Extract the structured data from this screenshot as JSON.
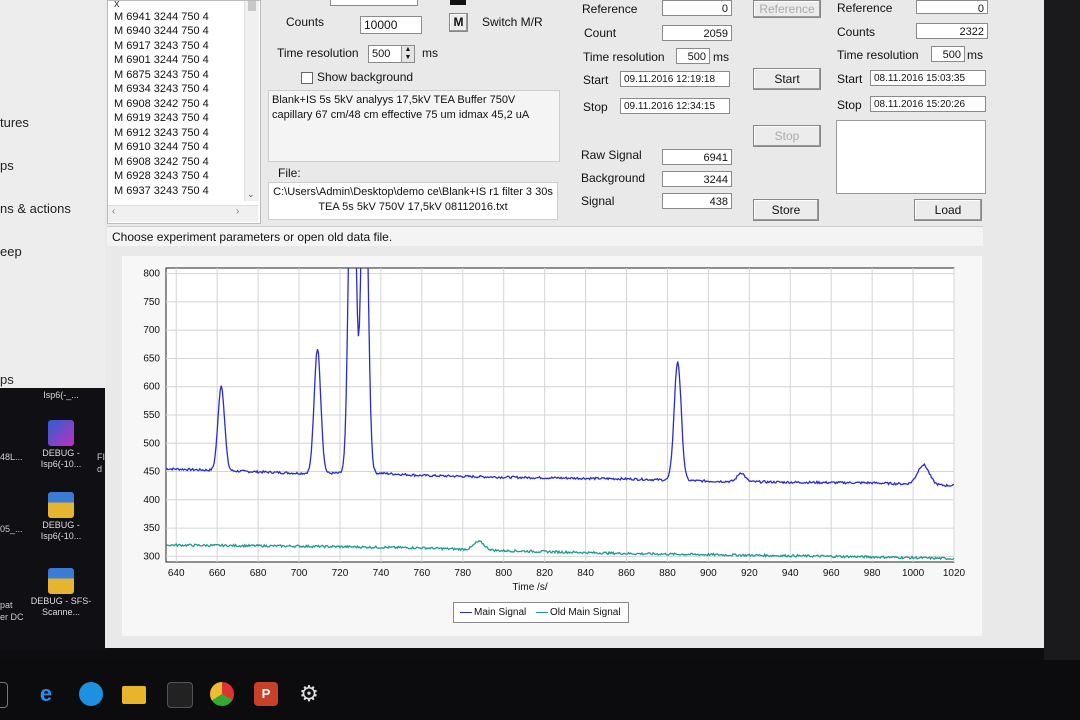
{
  "background_window": {
    "items": [
      "tures",
      "ps",
      "ns & actions",
      "eep",
      "ps"
    ]
  },
  "desktop": {
    "icons": [
      {
        "label": "Isp6(-_...",
        "color": "#1a1a1a"
      },
      {
        "label": "DEBUG - Isp6(-10...",
        "color": "#2a5fd0"
      },
      {
        "label": "DEBUG - Isp6(-10...",
        "color": "#3a7bd5"
      },
      {
        "label": "DEBUG - SFS-Scanne...",
        "color": "#3a7bd5"
      }
    ],
    "partial_labels": [
      "48L...",
      "05_...",
      "pat",
      "er DC",
      "FI",
      "d"
    ]
  },
  "taskbar": {
    "icons": [
      "windows-icon",
      "edge-icon",
      "skype-icon",
      "file-explorer-icon",
      "app-icon",
      "chrome-icon",
      "powerpoint-icon",
      "settings-icon"
    ]
  },
  "list": {
    "close": "x",
    "rows": [
      "M 6941 3244 750 4",
      "M 6940 3244 750 4",
      "M 6917 3243 750 4",
      "M 6901 3244 750 4",
      "M 6875 3243 750 4",
      "M 6934 3243 750 4",
      "M 6908 3242 750 4",
      "M 6919 3243 750 4",
      "M 6912 3243 750 4",
      "M 6910 3244 750 4",
      "M 6908 3242 750 4",
      "M 6928 3243 750 4",
      "M 6937 3243 750 4"
    ]
  },
  "params": {
    "counts_label": "Counts",
    "counts_value": "10000",
    "m_button": "M",
    "switch_label": "Switch M/R",
    "time_res_label": "Time resolution",
    "time_res_value": "500",
    "time_res_unit": "ms",
    "show_background_label": "Show background",
    "description": "Blank+IS 5s 5kV analyys 17,5kV TEA Buffer 750V capillary 67 cm/48 cm effective 75 um idmax 45,2 uA",
    "file_label": "File:",
    "file_path": "C:\\Users\\Admin\\Desktop\\demo ce\\Blank+IS r1 filter 3 30s TEA 5s 5kV 750V 17,5kV 08112016.txt"
  },
  "current": {
    "reference_label": "Reference",
    "reference_value": "0",
    "count_label": "Count",
    "count_value": "2059",
    "time_res_label": "Time resolution",
    "time_res_value": "500",
    "time_res_unit": "ms",
    "start_label": "Start",
    "start_value": "09.11.2016 12:19:18",
    "stop_label": "Stop",
    "stop_value": "09.11.2016 12:34:15",
    "raw_signal_label": "Raw Signal",
    "raw_signal_value": "6941",
    "background_label": "Background",
    "background_value": "3244",
    "signal_label": "Signal",
    "signal_value": "438"
  },
  "buttons": {
    "reference": "Reference",
    "start": "Start",
    "stop": "Stop",
    "store": "Store",
    "load": "Load"
  },
  "old": {
    "reference_label": "Reference",
    "reference_value": "0",
    "counts_label": "Counts",
    "counts_value": "2322",
    "time_res_label": "Time resolution",
    "time_res_value": "500",
    "time_res_unit": "ms",
    "start_label": "Start",
    "start_value": "08.11.2016 15:03:35",
    "stop_label": "Stop",
    "stop_value": "08.11.2016 15:20:26"
  },
  "status_text": "Choose experiment parameters or open old data file.",
  "colors": {
    "main_signal": "#2b2bd0",
    "old_main_signal": "#1e9a8e"
  },
  "chart_data": {
    "type": "line",
    "title": "",
    "xlabel": "Time /s/",
    "ylabel": "",
    "xlim": [
      635,
      1020
    ],
    "ylim": [
      290,
      810
    ],
    "xticks": [
      640,
      660,
      680,
      700,
      720,
      740,
      760,
      780,
      800,
      820,
      840,
      860,
      880,
      900,
      920,
      940,
      960,
      980,
      1000,
      1020
    ],
    "yticks": [
      300,
      350,
      400,
      450,
      500,
      550,
      600,
      650,
      700,
      750,
      800
    ],
    "grid": true,
    "legend": "bottom",
    "series": [
      {
        "name": "Main Signal",
        "baseline": [
          [
            635,
            455
          ],
          [
            700,
            447
          ],
          [
            740,
            447
          ],
          [
            760,
            443
          ],
          [
            800,
            440
          ],
          [
            860,
            437
          ],
          [
            900,
            433
          ],
          [
            940,
            431
          ],
          [
            980,
            430
          ],
          [
            1020,
            425
          ]
        ],
        "peaks": [
          {
            "x": 662,
            "height": 602,
            "width": 1.6
          },
          {
            "x": 709,
            "height": 668,
            "width": 1.6
          },
          {
            "x": 726,
            "height": 1200,
            "width": 1.6
          },
          {
            "x": 732,
            "height": 1100,
            "width": 1.6
          },
          {
            "x": 885,
            "height": 645,
            "width": 1.7
          },
          {
            "x": 916,
            "height": 448,
            "width": 1.8
          },
          {
            "x": 1005,
            "height": 462,
            "width": 2.8
          }
        ]
      },
      {
        "name": "Old Main Signal",
        "baseline": [
          [
            635,
            320
          ],
          [
            700,
            318
          ],
          [
            760,
            315
          ],
          [
            800,
            310
          ],
          [
            860,
            305
          ],
          [
            920,
            302
          ],
          [
            980,
            299
          ],
          [
            1020,
            296
          ]
        ],
        "peaks": [
          {
            "x": 788,
            "height": 326,
            "width": 2.5
          }
        ]
      }
    ]
  }
}
